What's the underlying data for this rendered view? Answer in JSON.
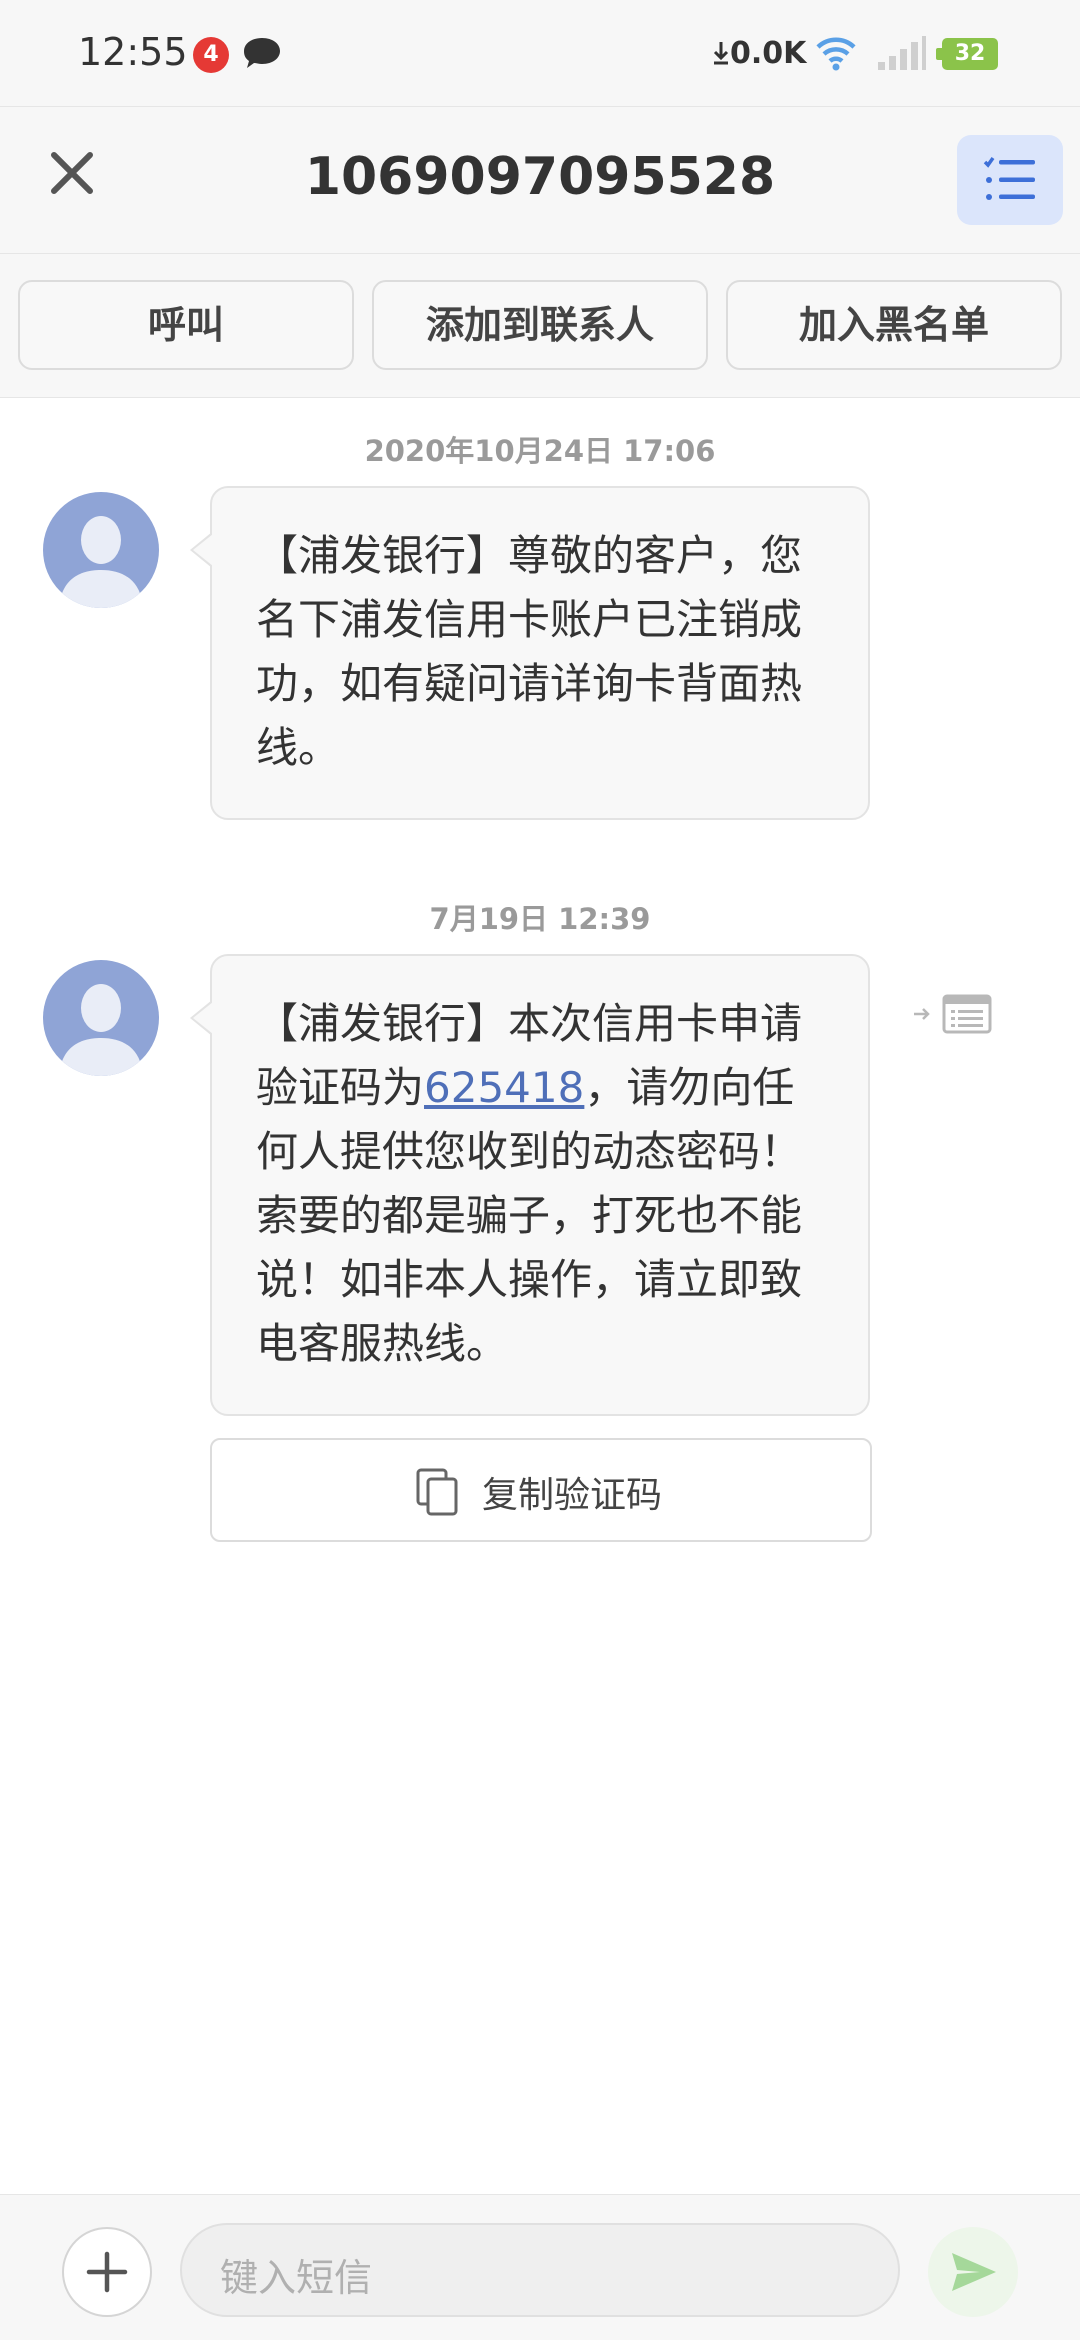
{
  "status_bar": {
    "time": "12:55",
    "notification_count": "4",
    "net_speed": "0.0K",
    "battery": "32"
  },
  "header": {
    "title": "1069097095528"
  },
  "actions": {
    "call": "呼叫",
    "add_contact": "添加到联系人",
    "blacklist": "加入黑名单"
  },
  "messages": [
    {
      "timestamp": "2020年10月24日 17:06",
      "text": "【浦发银行】尊敬的客户，您名下浦发信用卡账户已注销成功，如有疑问请详询卡背面热线。"
    },
    {
      "timestamp": "7月19日 12:39",
      "text_before": "【浦发银行】本次信用卡申请验证码为",
      "code": "625418",
      "text_after": "，请勿向任何人提供您收到的动态密码！索要的都是骗子，打死也不能说！如非本人操作，请立即致电客服热线。",
      "copy_button": "复制验证码"
    }
  ],
  "compose": {
    "placeholder": "键入短信"
  },
  "colors": {
    "accent": "#4f6fb8",
    "avatar": "#8fa4d6",
    "send": "#a5d89a"
  }
}
